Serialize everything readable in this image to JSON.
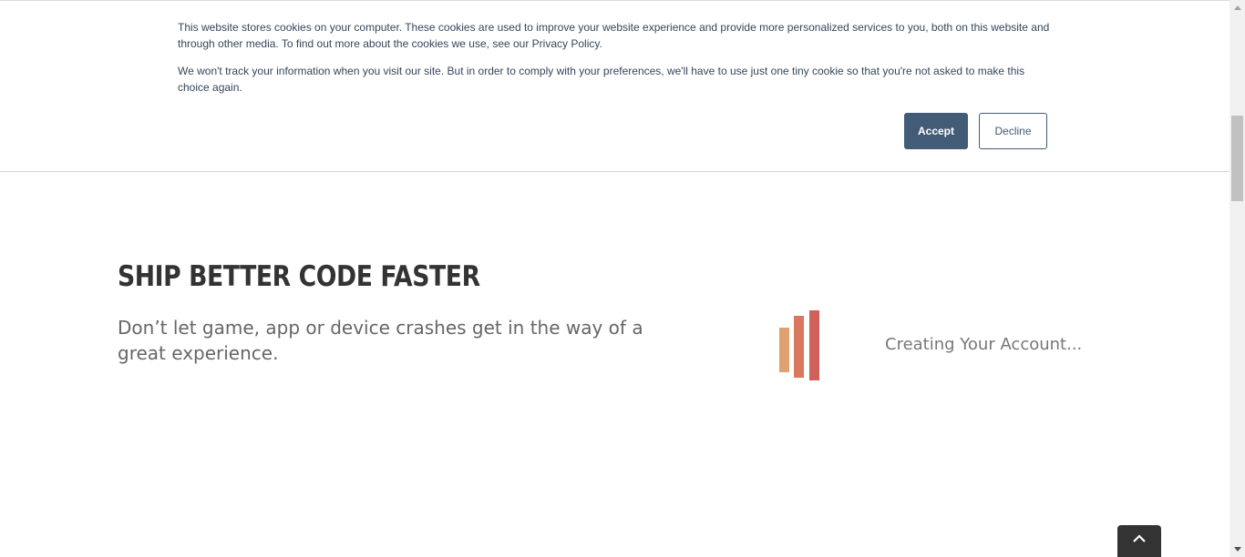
{
  "cookie_banner": {
    "text_1": "This website stores cookies on your computer. These cookies are used to improve your website experience and provide more personalized services to you, both on this website and through other media. To find out more about the cookies we use, see our Privacy Policy.",
    "text_2": "We won't track your information when you visit our site. But in order to comply with your preferences, we'll have to use just one tiny cookie so that you're not asked to make this choice again.",
    "accept_label": "Accept",
    "decline_label": "Decline",
    "accent_color": "#425b76"
  },
  "hero": {
    "title": "SHIP BETTER CODE FASTER",
    "subtitle": "Don’t let game, app or device crashes get in the way of a great experience."
  },
  "loader": {
    "status_text": "Creating Your Account...",
    "bar_colors": [
      "#e0a070",
      "#d9785f",
      "#d0605a"
    ]
  },
  "controls": {
    "back_to_top_icon": "chevron-up-icon",
    "scroll_up_icon": "triangle-up-icon",
    "scroll_down_icon": "triangle-down-icon"
  }
}
